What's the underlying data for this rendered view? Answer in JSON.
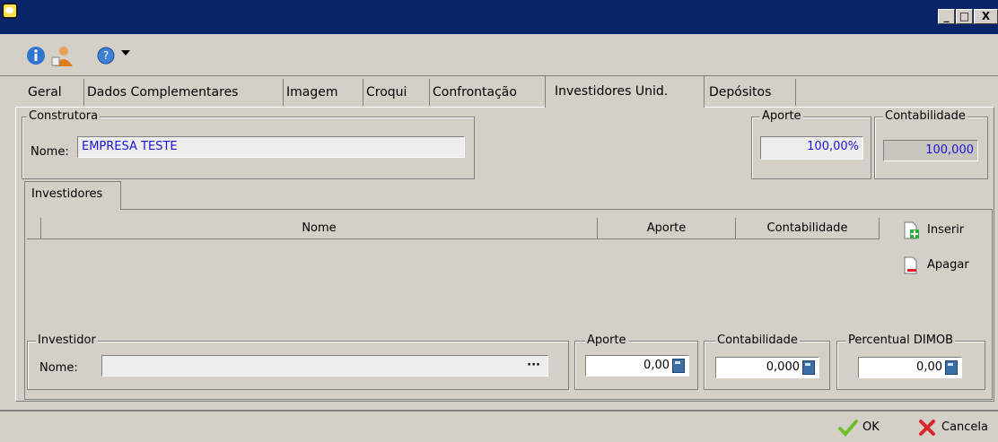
{
  "tabs": [
    "Geral",
    "Dados Complementares",
    "Imagem",
    "Croqui",
    "Confrontação",
    "Investidores Unid.",
    "Depósitos"
  ],
  "construtora": {
    "legend": "Construtora",
    "nome_label": "Nome:",
    "nome_value": "EMPRESA TESTE"
  },
  "aporte_top": {
    "legend": "Aporte",
    "value": "100,00%"
  },
  "contabilidade_top": {
    "legend": "Contabilidade",
    "value": "100,000"
  },
  "subtab": "Investidores",
  "grid": {
    "columns": [
      "Nome",
      "Aporte",
      "Contabilidade"
    ]
  },
  "side": {
    "insert": "Inserir",
    "delete": "Apagar"
  },
  "investidor": {
    "legend": "Investidor",
    "nome_label": "Nome:",
    "ellipsis": "···"
  },
  "aporte": {
    "legend": "Aporte",
    "value": "0,00"
  },
  "contabilidade": {
    "legend": "Contabilidade",
    "value": "0,000"
  },
  "percentual": {
    "legend": "Percentual DIMOB",
    "value": "0,00"
  },
  "footer": {
    "ok": "OK",
    "cancel": "Cancela"
  },
  "window_buttons": {
    "minimize": "_",
    "maximize": "□",
    "close": "X"
  }
}
